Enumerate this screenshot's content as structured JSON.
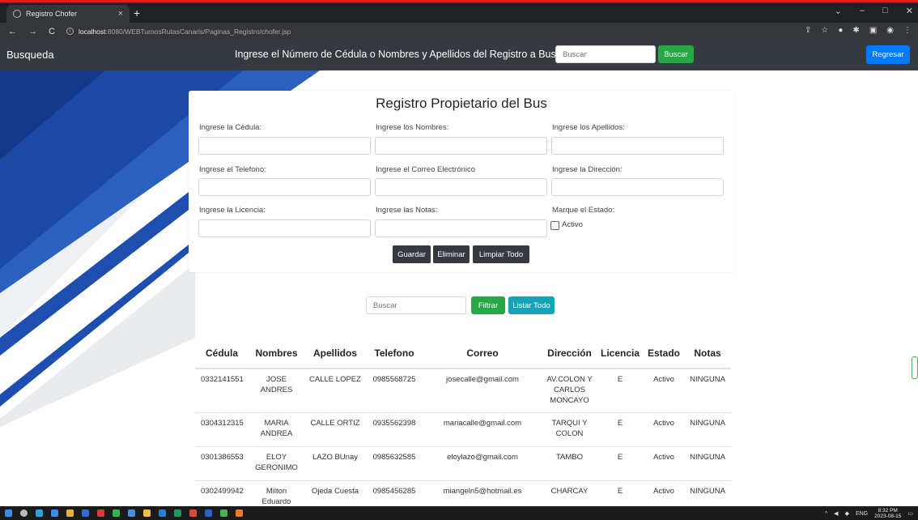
{
  "browser": {
    "tab_title": "Registro Chofer",
    "tab_close": "×",
    "new_tab": "+",
    "url_host": "localhost",
    "url_path": ":8080/WEBTurnosRutasCanaris/Paginas_Registro/chofer.jsp",
    "win_min": "‒",
    "win_max": "□",
    "win_close": "✕"
  },
  "navbar": {
    "brand": "Busqueda",
    "prompt": "Ingrese el Número de Cédula o Nombres y Apellidos del Registro a Buscar",
    "search_placeholder": "Buscar",
    "search_button": "Buscar",
    "back_button": "Regresar"
  },
  "form": {
    "title": "Registro Propietario del Bus",
    "labels": {
      "cedula": "Ingrese la Cédula:",
      "nombres": "Ingrese los Nombres:",
      "apellidos": "Ingrese los Apellidos:",
      "telefono": "Ingrese el Telefono:",
      "correo": "Ingrese el Correo Electrónico",
      "direccion": "Ingrese la Dirección:",
      "licencia": "Ingrese la Licencia:",
      "notas": "Ingrese las Notas:",
      "estado": "Marque el Estado:",
      "activo": "Activo"
    },
    "buttons": {
      "guardar": "Guardar",
      "eliminar": "Eliminar",
      "limpiar": "Limpiar Todo"
    }
  },
  "filter": {
    "placeholder": "Buscar",
    "filtrar": "Filtrar",
    "listar": "Listar Todo"
  },
  "table": {
    "headers": [
      "Cédula",
      "Nombres",
      "Apellidos",
      "Telefono",
      "Correo",
      "Dirección",
      "Licencia",
      "Estado",
      "Notas"
    ],
    "rows": [
      [
        "0332141551",
        "JOSE ANDRES",
        "CALLE LOPEZ",
        "0985568725",
        "josecalle@gmail.com",
        "AV.COLON Y CARLOS MONCAYO",
        "E",
        "Activo",
        "NINGUNA"
      ],
      [
        "0304312315",
        "MARIA ANDREA",
        "CALLE ORTIZ",
        "0935562398",
        "mariacalle@gmail.com",
        "TARQUI Y COLON",
        "E",
        "Activo",
        "NINGUNA"
      ],
      [
        "0301386553",
        "ELOY GERONIMO",
        "LAZO BUnay",
        "0985632585",
        "eloylazo@gmail.com",
        "TAMBO",
        "E",
        "Activo",
        "NINGUNA"
      ],
      [
        "0302499942",
        "Milton Eduardo",
        "Ojeda Cuesta",
        "0985456285",
        "miangeln5@hotmail.es",
        "CHARCAY",
        "E",
        "Activo",
        "NINGUNA"
      ]
    ]
  },
  "taskbar": {
    "lang": "ENG",
    "time": "8:32 PM",
    "date": "2023-08-15"
  },
  "colors": {
    "navbar_bg": "#343a40",
    "accent_blue": "#007bff",
    "success_green": "#28a745",
    "info_teal": "#17a2b8",
    "deco_blue": "#1c49a8"
  }
}
